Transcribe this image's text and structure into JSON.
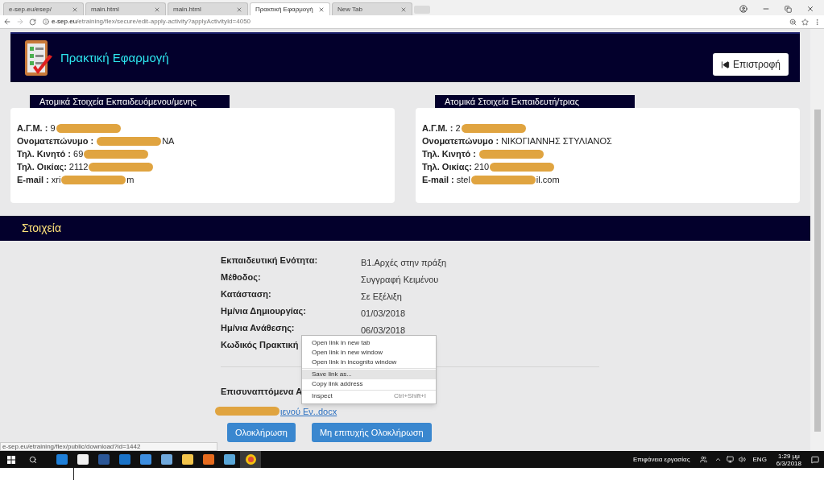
{
  "browser": {
    "tabs": [
      {
        "title": "e-sep.eu/esep/",
        "selected": false
      },
      {
        "title": "main.html",
        "selected": false
      },
      {
        "title": "main.html",
        "selected": false
      },
      {
        "title": "Πρακτική Εφαρμογή",
        "selected": true
      },
      {
        "title": "New Tab",
        "selected": false
      }
    ],
    "url_host": "e-sep.eu",
    "url_path": "/etraining/flex/secure/edit-apply-activity?applyActivityId=4050"
  },
  "header": {
    "title": "Πρακτική Εφαρμογή",
    "back_button": "Επιστροφή"
  },
  "cards": [
    {
      "heading": "Ατομικά Στοιχεία Εκπαιδευόμενου/μενης",
      "fields": [
        {
          "label": "Α.Γ.Μ. :",
          "value": "9",
          "redacted": true
        },
        {
          "label": "Ονοματεπώνυμο :",
          "value_end": "ΝΑ",
          "redacted": true
        },
        {
          "label": "Τηλ. Κινητό :",
          "value": "69",
          "redacted": true
        },
        {
          "label": "Τηλ. Οικίας:",
          "value": "2112",
          "redacted": true
        },
        {
          "label": "E-mail :",
          "value": "xri",
          "value_end": "m",
          "redacted": true
        }
      ]
    },
    {
      "heading": "Ατομικά Στοιχεία Εκπαιδευτή/τριας",
      "fields": [
        {
          "label": "Α.Γ.Μ. :",
          "value": "2",
          "redacted": true
        },
        {
          "label": "Ονοματεπώνυμο :",
          "value": "ΝΙΚΟΓΙΑΝΝΗΣ ΣΤΥΛΙΑΝΟΣ"
        },
        {
          "label": "Τηλ. Κινητό :",
          "redacted": true
        },
        {
          "label": "Τηλ. Οικίας:",
          "value": "210",
          "redacted": true
        },
        {
          "label": "E-mail :",
          "value": "stel",
          "value_end": "il.com",
          "redacted": true
        }
      ]
    }
  ],
  "section_title": "Στοιχεία",
  "details": [
    {
      "label": "Εκπαιδευτική Ενότητα:",
      "value": "Β1.Αρχές στην πράξη"
    },
    {
      "label": "Μέθοδος:",
      "value": "Συγγραφή Κειμένου"
    },
    {
      "label": "Κατάσταση:",
      "value": "Σε Εξέλιξη"
    },
    {
      "label": "Ημ/νια Δημιουργίας:",
      "value": "01/03/2018"
    },
    {
      "label": "Ημ/νια Ανάθεσης:",
      "value": "06/03/2018"
    },
    {
      "label": "Κωδικός Πρακτική"
    }
  ],
  "attachments_label": "Επισυναπτόμενα Α",
  "attachment_link": "ιενού Εν..docx",
  "buttons": [
    "Ολοκλήρωση",
    "Μη επιτυχής Ολοκλήρωση"
  ],
  "context_menu": {
    "groups": [
      [
        {
          "label": "Open link in new tab",
          "selected": false
        },
        {
          "label": "Open link in new window",
          "selected": false
        },
        {
          "label": "Open link in incognito window",
          "selected": false
        }
      ],
      [
        {
          "label": "Save link as...",
          "selected": true
        },
        {
          "label": "Copy link address",
          "selected": false
        }
      ],
      [
        {
          "label": "Inspect",
          "shortcut": "Ctrl+Shift+I",
          "selected": false
        }
      ]
    ]
  },
  "status_url": "e-sep.eu/etraining/flex/public/download?id=1442",
  "taskbar": {
    "desktop_label": "Επιφάνεια εργασίας",
    "language": "ENG",
    "time": "1:29 μμ",
    "date": "6/3/2018"
  }
}
